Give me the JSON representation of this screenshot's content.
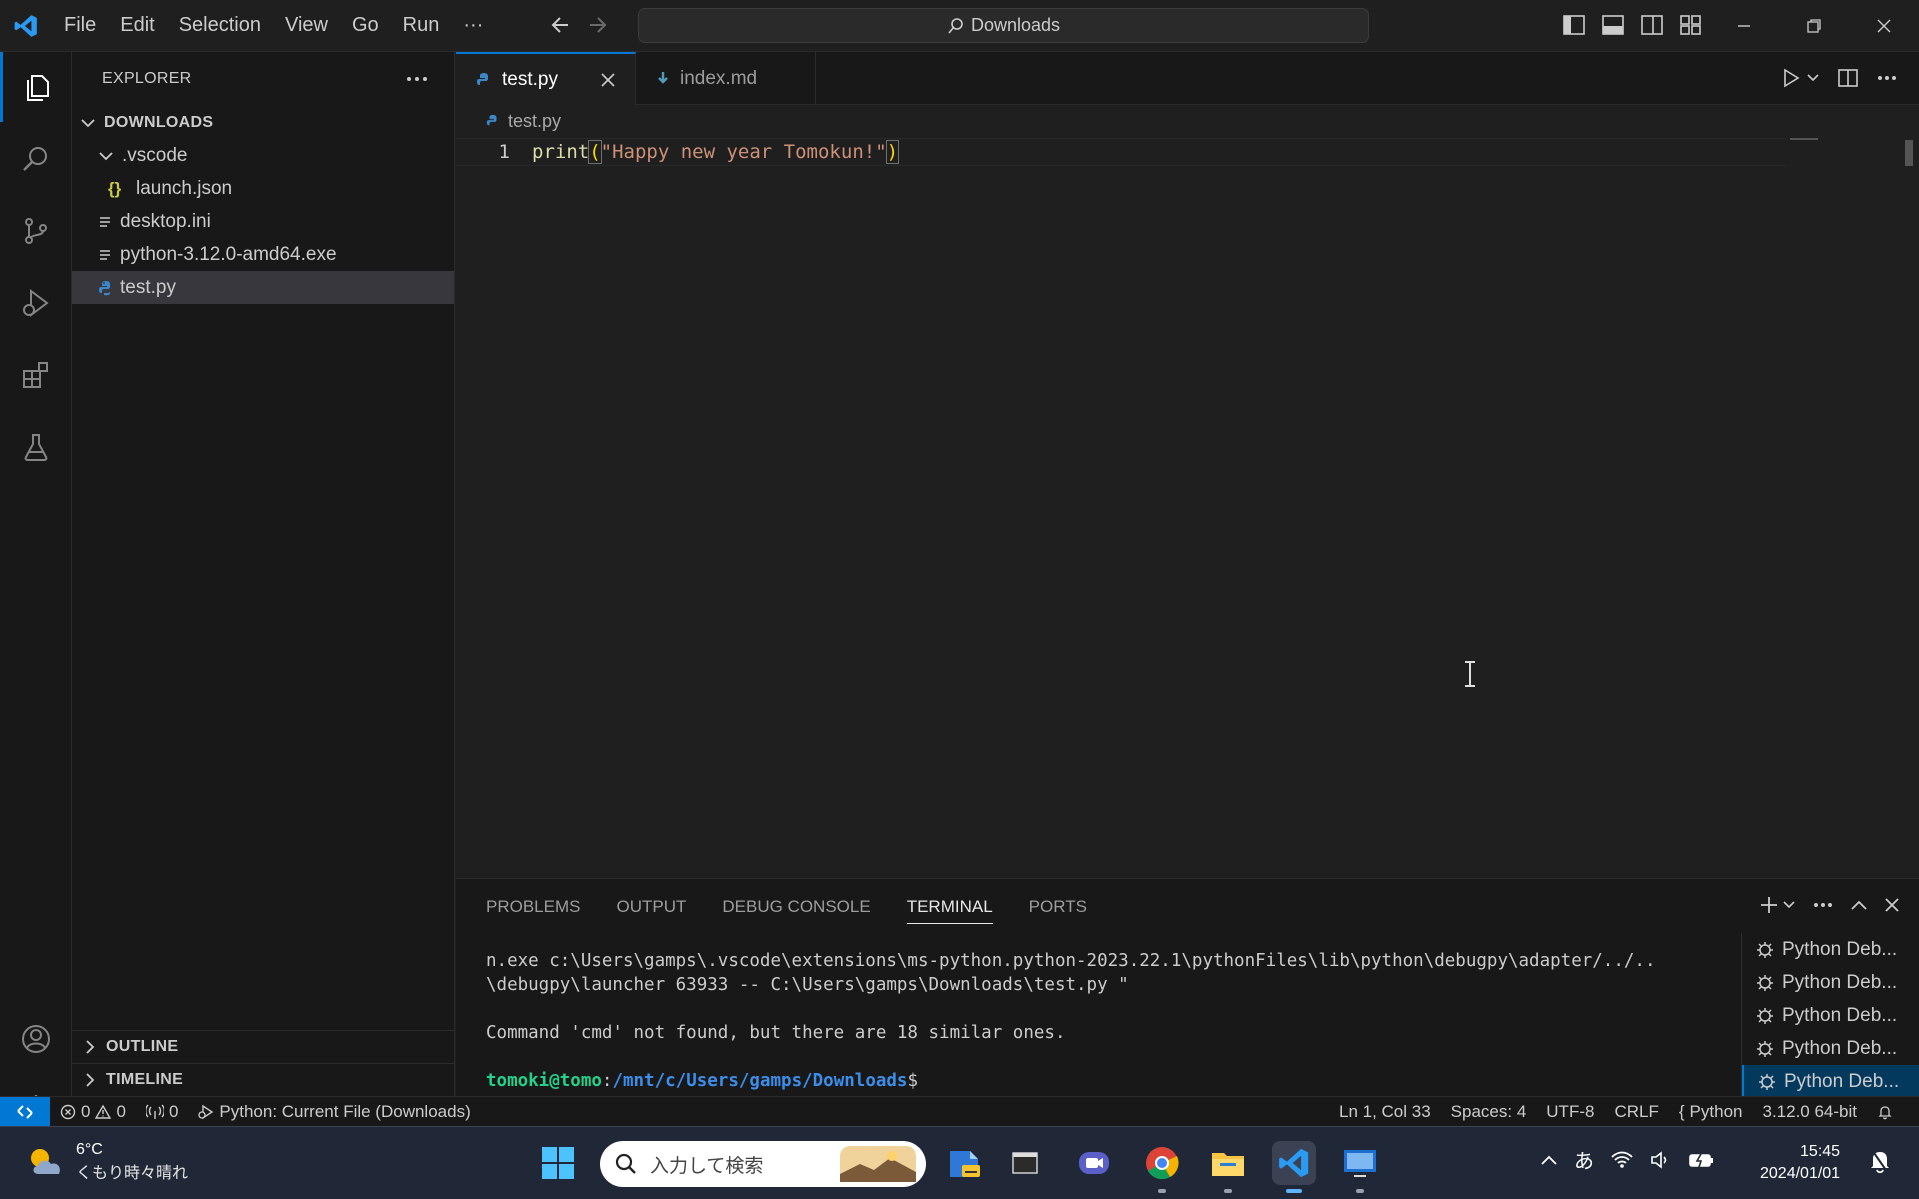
{
  "titlebar": {
    "menu": [
      "File",
      "Edit",
      "Selection",
      "View",
      "Go",
      "Run"
    ],
    "more_label": "···",
    "search_text": "Downloads"
  },
  "sidebar": {
    "header": "EXPLORER",
    "root": "DOWNLOADS",
    "items": [
      {
        "label": ".vscode",
        "icon": "chevron-down-icon",
        "depth": 1
      },
      {
        "label": "launch.json",
        "icon": "json-icon",
        "depth": 2
      },
      {
        "label": "desktop.ini",
        "icon": "file-lines-icon",
        "depth": 1
      },
      {
        "label": "python-3.12.0-amd64.exe",
        "icon": "file-lines-icon",
        "depth": 1
      },
      {
        "label": "test.py",
        "icon": "python-icon",
        "depth": 1,
        "selected": true
      }
    ],
    "outline": "OUTLINE",
    "timeline": "TIMELINE"
  },
  "editor": {
    "tabs": [
      {
        "label": "test.py",
        "active": true
      },
      {
        "label": "index.md",
        "active": false
      }
    ],
    "breadcrumb": "test.py",
    "lines": [
      {
        "number": "1",
        "fn": "print",
        "open": "(",
        "str": "\"Happy new year Tomokun!\"",
        "close": ")"
      }
    ]
  },
  "panel": {
    "tabs": [
      "PROBLEMS",
      "OUTPUT",
      "DEBUG CONSOLE",
      "TERMINAL",
      "PORTS"
    ],
    "active_tab": "TERMINAL",
    "terminal": {
      "line1": "n.exe c:\\Users\\gamps\\.vscode\\extensions\\ms-python.python-2023.22.1\\pythonFiles\\lib\\python\\debugpy\\adapter/../..",
      "line2": "\\debugpy\\launcher 63933 -- C:\\Users\\gamps\\Downloads\\test.py \"",
      "line3": "",
      "line4": "Command 'cmd' not found, but there are 18 similar ones.",
      "line5": "",
      "prompt_user": "tomoki@tomo",
      "prompt_sep": ":",
      "prompt_path": "/mnt/c/Users/gamps/Downloads",
      "prompt_end": "$"
    },
    "terminal_list": [
      "Python Deb...",
      "Python Deb...",
      "Python Deb...",
      "Python Deb...",
      "Python Deb..."
    ]
  },
  "statusbar": {
    "errors": "0",
    "warnings": "0",
    "ports": "0",
    "debug": "Python: Current File (Downloads)",
    "position": "Ln 1, Col 33",
    "spaces": "Spaces: 4",
    "encoding": "UTF-8",
    "eol": "CRLF",
    "language": "Python",
    "interpreter": "3.12.0 64-bit"
  },
  "taskbar": {
    "weather_temp": "6°C",
    "weather_desc": "くもり時々晴れ",
    "search_placeholder": "入力して検索",
    "ime": "あ",
    "time": "15:45",
    "date": "2024/01/01"
  },
  "colors": {
    "accent": "#0078d4",
    "background": "#1f1f1f",
    "sidebar": "#181818",
    "string": "#ce9178",
    "function": "#dcdcaa"
  }
}
